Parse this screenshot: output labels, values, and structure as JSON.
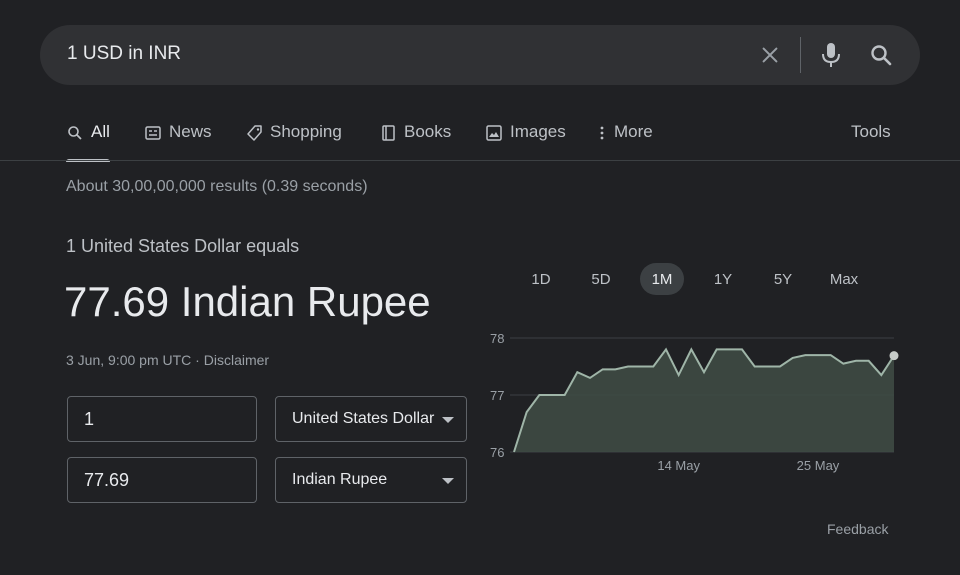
{
  "search": {
    "query": "1 USD in INR"
  },
  "tabs": [
    {
      "label": "All",
      "icon": "search-icon"
    },
    {
      "label": "News",
      "icon": "news-icon"
    },
    {
      "label": "Shopping",
      "icon": "tag-icon"
    },
    {
      "label": "Books",
      "icon": "book-icon"
    },
    {
      "label": "Images",
      "icon": "image-icon"
    },
    {
      "label": "More",
      "icon": "more-vertical-icon"
    }
  ],
  "tools_label": "Tools",
  "results_count": "About 30,00,00,000 results (0.39 seconds)",
  "converter": {
    "equals_label": "1 United States Dollar equals",
    "result": "77.69 Indian Rupee",
    "timestamp": "3 Jun, 9:00 pm UTC",
    "separator": " · ",
    "disclaimer": "Disclaimer",
    "from_amount": "1",
    "from_currency": "United States Dollar",
    "to_amount": "77.69",
    "to_currency": "Indian Rupee"
  },
  "ranges": [
    "1D",
    "5D",
    "1M",
    "1Y",
    "5Y",
    "Max"
  ],
  "active_range": "1M",
  "feedback": "Feedback",
  "colors": {
    "background": "#202124",
    "chart_line": "#9fb5a8",
    "chart_fill": "#3e4a44"
  },
  "chart_data": {
    "type": "area",
    "ylim": [
      76,
      78
    ],
    "yticks": [
      76,
      77,
      78
    ],
    "xtick_labels": [
      {
        "label": "14 May",
        "index": 13
      },
      {
        "label": "25 May",
        "index": 24
      }
    ],
    "values": [
      76.0,
      76.7,
      77.0,
      77.0,
      77.0,
      77.4,
      77.3,
      77.45,
      77.45,
      77.5,
      77.5,
      77.5,
      77.8,
      77.35,
      77.8,
      77.4,
      77.8,
      77.8,
      77.8,
      77.5,
      77.5,
      77.5,
      77.65,
      77.7,
      77.7,
      77.7,
      77.55,
      77.6,
      77.6,
      77.35,
      77.69
    ]
  }
}
